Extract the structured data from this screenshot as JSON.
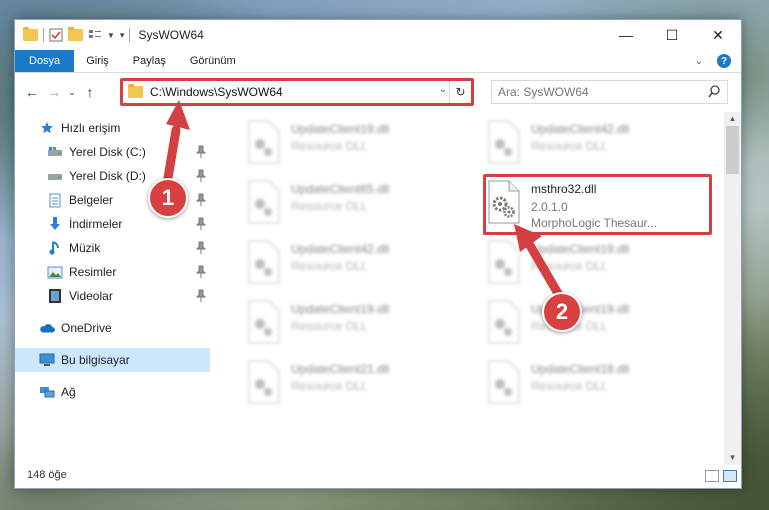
{
  "window": {
    "title": "SysWOW64"
  },
  "ribbon": {
    "tabs": [
      "Dosya",
      "Giriş",
      "Paylaş",
      "Görünüm"
    ]
  },
  "address": {
    "path": "C:\\Windows\\SysWOW64"
  },
  "search": {
    "placeholder": "Ara: SysWOW64"
  },
  "nav": {
    "items": [
      {
        "label": "Hızlı erişim",
        "icon": "star-icon"
      },
      {
        "label": "Yerel Disk (C:)",
        "icon": "drive-icon"
      },
      {
        "label": "Yerel Disk (D:)",
        "icon": "drive-icon"
      },
      {
        "label": "Belgeler",
        "icon": "documents-icon"
      },
      {
        "label": "İndirmeler",
        "icon": "download-icon"
      },
      {
        "label": "Müzik",
        "icon": "music-icon"
      },
      {
        "label": "Resimler",
        "icon": "pictures-icon"
      },
      {
        "label": "Videolar",
        "icon": "videos-icon"
      },
      {
        "label": "OneDrive",
        "icon": "cloud-icon"
      },
      {
        "label": "Bu bilgisayar",
        "icon": "computer-icon"
      },
      {
        "label": "Ağ",
        "icon": "network-icon"
      }
    ]
  },
  "files": {
    "left": [
      {
        "name": "UpdateClient19.dll",
        "type": "Resource DLL"
      },
      {
        "name": "UpdateClient65.dll",
        "type": "Resource DLL"
      },
      {
        "name": "UpdateClient42.dll",
        "type": "Resource DLL"
      },
      {
        "name": "UpdateClient19.dll",
        "type": "Resource DLL"
      },
      {
        "name": "UpdateClient21.dll",
        "type": "Resource DLL"
      }
    ],
    "right": [
      {
        "name": "UpdateClient42.dll",
        "type": "Resource DLL"
      },
      {
        "name": "UpdateClient19.dll",
        "type": "Resource DLL"
      },
      {
        "name": "UpdateClient19.dll",
        "type": "Resource DLL"
      },
      {
        "name": "UpdateClient18.dll",
        "type": "Resource DLL"
      }
    ],
    "highlighted": {
      "name": "msthro32.dll",
      "version": "2.0.1.0",
      "description": "MorphoLogic Thesaur..."
    }
  },
  "status": {
    "count": "148 öğe"
  },
  "callouts": [
    "1",
    "2"
  ],
  "colors": {
    "accent": "#1979ca",
    "highlight": "#d43f3f"
  }
}
